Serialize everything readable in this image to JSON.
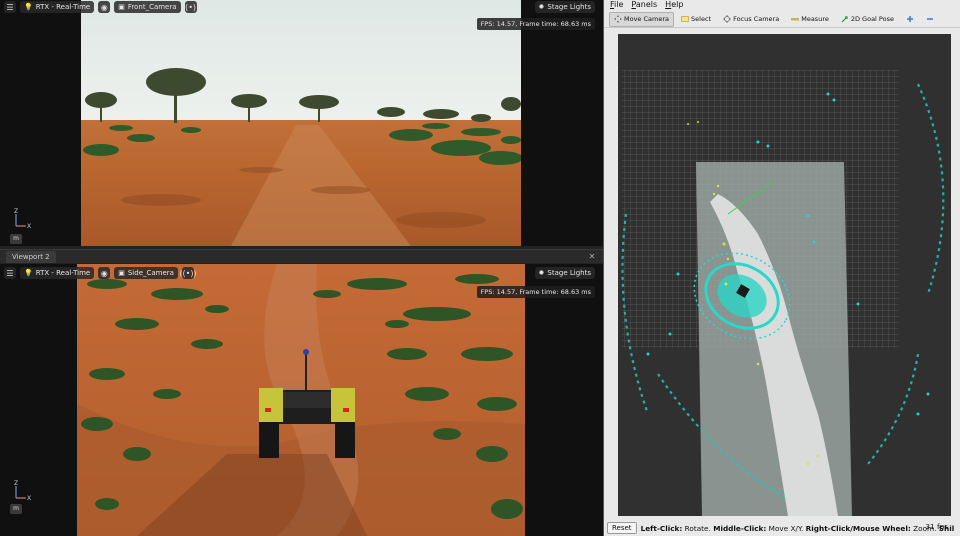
{
  "isaac": {
    "viewport1": {
      "renderer": "RTX - Real-Time",
      "camera": "Front_Camera",
      "stage_lights": "Stage Lights",
      "fps_text": "FPS: 14.57, Frame time: 68.63 ms",
      "unit": "m",
      "axis_z": "Z",
      "axis_x": "X"
    },
    "viewport2": {
      "tab_label": "Viewport 2",
      "renderer": "RTX - Real-Time",
      "camera": "Side_Camera",
      "stage_lights": "Stage Lights",
      "fps_text": "FPS: 14.57, Frame time: 68.63 ms",
      "unit": "m",
      "axis_z": "Z",
      "axis_x": "X"
    }
  },
  "rviz": {
    "menu": [
      "File",
      "Panels",
      "Help"
    ],
    "tools": {
      "move_camera": "Move Camera",
      "select": "Select",
      "focus_camera": "Focus Camera",
      "measure": "Measure",
      "goal_pose": "2D Goal Pose"
    },
    "status": {
      "reset": "Reset",
      "left_click_label": "Left-Click:",
      "left_click_text": "Rotate.",
      "middle_click_label": "Middle-Click:",
      "middle_click_text": "Move X/Y.",
      "right_click_label": "Right-Click/Mouse Wheel:",
      "right_click_text": "Zoom.",
      "shift_label": "Shil",
      "fps": "31 fps"
    }
  },
  "colors": {
    "cloud_cyan": "#1fd0c0",
    "cloud_yellow": "#d8e63a",
    "grid": "#8a8a8a",
    "dirt": "#b5622e",
    "sky": "#e4ebe9"
  }
}
